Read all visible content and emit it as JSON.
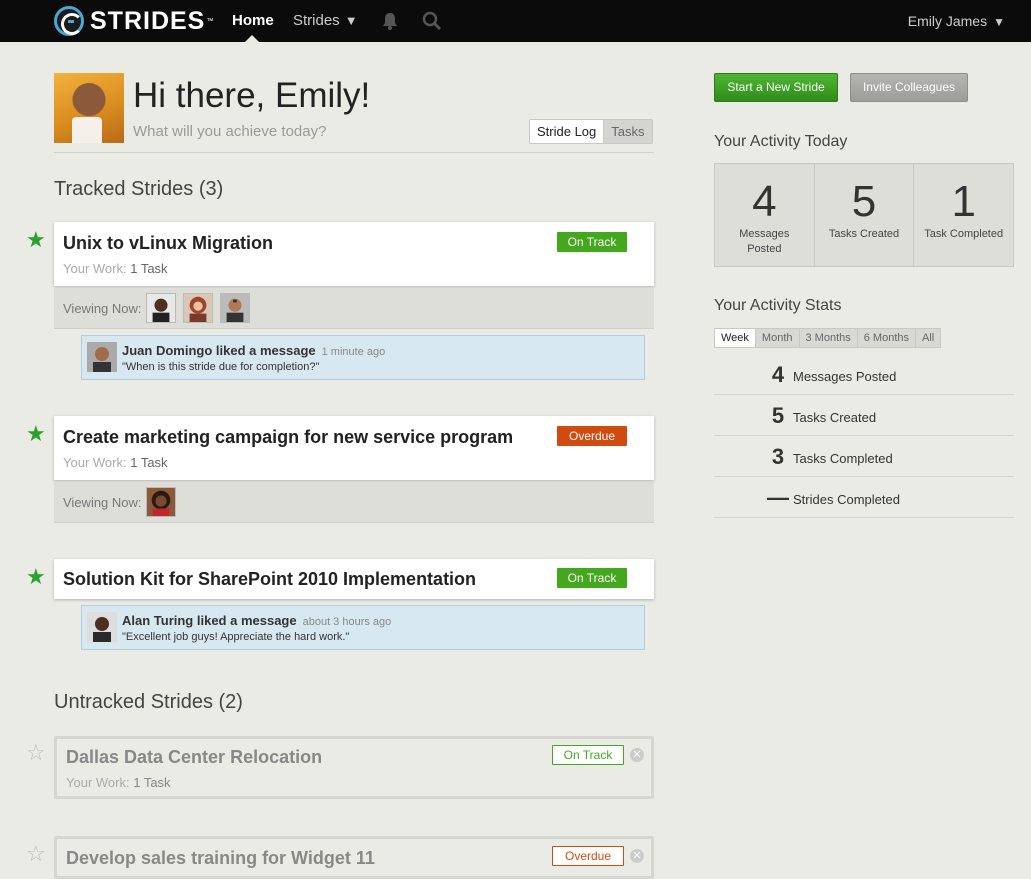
{
  "nav": {
    "logo_text": "STRIDES",
    "logo_tm": "™",
    "home": "Home",
    "strides": "Strides",
    "strides_arrow": "▼",
    "user_name": "Emily James",
    "user_arrow": "▼"
  },
  "greeting": {
    "title": "Hi there, Emily!",
    "subtitle": "What will you achieve today?",
    "toggle_active": "Stride Log",
    "toggle_inactive": "Tasks"
  },
  "tracked": {
    "heading": "Tracked Strides (3)",
    "items": [
      {
        "title": "Unix to vLinux Migration",
        "work_label": "Your Work:",
        "work_value": "1 Task",
        "status": "On Track",
        "viewing_label": "Viewing Now:",
        "activity": {
          "actor": "Juan Domingo liked a message",
          "time": "1 minute ago",
          "quote": "\"When is this stride due for completion?\""
        }
      },
      {
        "title": "Create marketing campaign for new service program",
        "work_label": "Your Work:",
        "work_value": "1 Task",
        "status": "Overdue",
        "viewing_label": "Viewing Now:"
      },
      {
        "title": "Solution Kit for SharePoint 2010 Implementation",
        "status": "On Track",
        "activity": {
          "actor": "Alan Turing liked a message",
          "time": "about 3 hours ago",
          "quote": "\"Excellent job guys! Appreciate the hard work.\""
        }
      }
    ]
  },
  "untracked": {
    "heading": "Untracked Strides (2)",
    "items": [
      {
        "title": "Dallas Data Center Relocation",
        "work_label": "Your Work:",
        "work_value": "1 Task",
        "status": "On Track"
      },
      {
        "title": "Develop sales training for Widget 11",
        "status": "Overdue"
      }
    ]
  },
  "sidebar": {
    "start_button": "Start a New Stride",
    "invite_button": "Invite Colleagues",
    "today_title": "Your Activity Today",
    "today": [
      {
        "value": "4",
        "label": "Messages Posted"
      },
      {
        "value": "5",
        "label": "Tasks Created"
      },
      {
        "value": "1",
        "label": "Task Completed"
      }
    ],
    "stats_title": "Your Activity Stats",
    "periods": [
      "Week",
      "Month",
      "3 Months",
      "6 Months",
      "All"
    ],
    "stats": [
      {
        "value": "4",
        "label": "Messages Posted"
      },
      {
        "value": "5",
        "label": "Tasks Created"
      },
      {
        "value": "3",
        "label": "Tasks Completed"
      },
      {
        "value": "—",
        "label": "Strides Completed"
      }
    ]
  },
  "colors": {
    "on_track": "#44a81f",
    "overdue": "#d14a10",
    "primary_button": "#3a9e22",
    "activity_bg": "#d8e8f1"
  }
}
